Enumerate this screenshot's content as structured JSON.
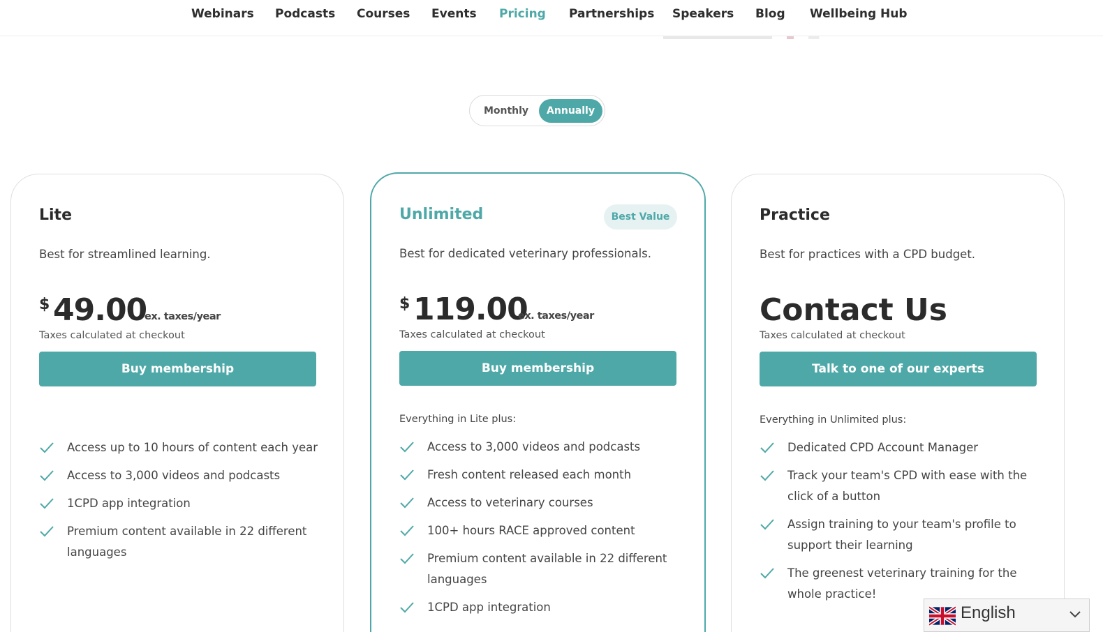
{
  "nav": {
    "items": [
      {
        "label": "Webinars"
      },
      {
        "label": "Podcasts"
      },
      {
        "label": "Courses"
      },
      {
        "label": "Events"
      },
      {
        "label": "Pricing",
        "active": true
      },
      {
        "label": "Partnerships"
      },
      {
        "label": "Speakers"
      },
      {
        "label": "Blog"
      },
      {
        "label": "Wellbeing Hub"
      }
    ]
  },
  "billing_toggle": {
    "options": [
      "Monthly",
      "Annually"
    ],
    "selected": "Annually"
  },
  "plans": [
    {
      "name": "Lite",
      "description": "Best for streamlined learning.",
      "currency": "$",
      "price": "49.00",
      "period": "ex. taxes/year",
      "tax_note": "Taxes calculated at checkout",
      "cta": "Buy membership",
      "features_intro": "",
      "features": [
        "Access up to 10 hours of content each year",
        "Access to 3,000 videos and podcasts",
        "1CPD app integration",
        "Premium content available in 22 different languages"
      ]
    },
    {
      "name": "Unlimited",
      "badge": "Best Value",
      "description": "Best for dedicated veterinary professionals.",
      "currency": "$",
      "price": "119.00",
      "period": "ex. taxes/year",
      "tax_note": "Taxes calculated at checkout",
      "cta": "Buy membership",
      "features_intro": "Everything in Lite plus:",
      "features": [
        "Access to 3,000 videos and podcasts",
        "Fresh content released each month",
        "Access to veterinary courses",
        "100+ hours RACE approved content",
        "Premium content available in 22 different languages",
        "1CPD app integration"
      ]
    },
    {
      "name": "Practice",
      "description": "Best for practices with a CPD budget.",
      "price_text": "Contact Us",
      "tax_note": "Taxes calculated at checkout",
      "cta": "Talk to one of our experts",
      "features_intro": "Everything in Unlimited plus:",
      "features": [
        "Dedicated CPD Account Manager",
        "Track your team's CPD with ease with the click of a button",
        "Assign training to your team's profile to support their learning",
        "The greenest veterinary training for the whole practice!"
      ]
    }
  ],
  "language_selector": {
    "label": "English",
    "flag_icon": "uk-flag-icon"
  },
  "colors": {
    "accent": "#4fa8a8",
    "accent_light": "#e6f2f2",
    "text_dark": "#2b2b2b"
  }
}
